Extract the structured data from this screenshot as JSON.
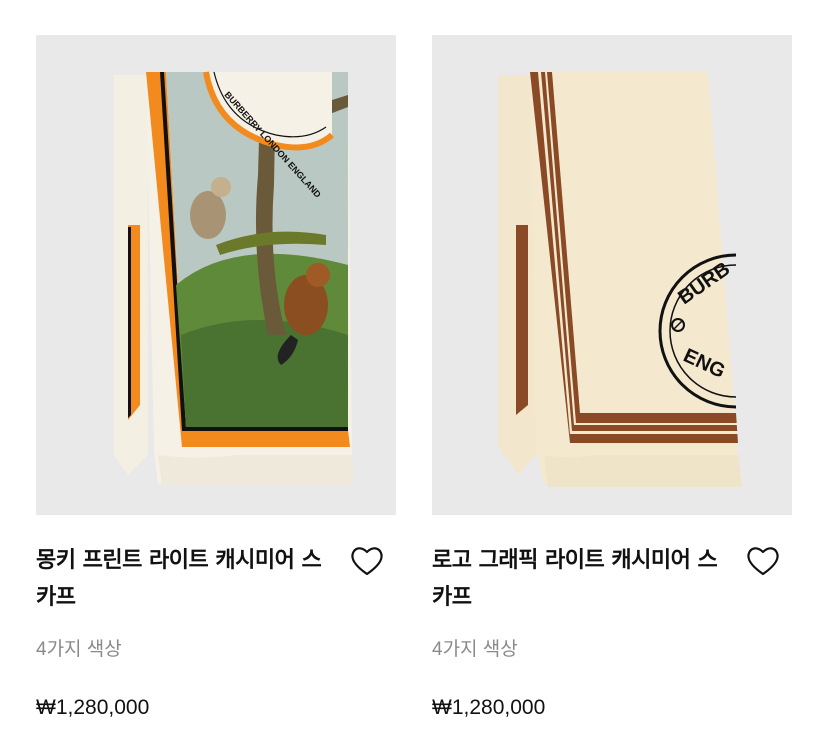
{
  "products": [
    {
      "title": "몽키 프린트 라이트 캐시미어 스카프",
      "colors": "4가지 색상",
      "price": "₩1,280,000",
      "image_icon": "monkey-print-scarf-image",
      "wishlist_icon": "heart-icon",
      "print_text": "BURBERRY LONDON ENGLAND",
      "accent_color": "#f28a1e"
    },
    {
      "title": "로고 그래픽 라이트 캐시미어 스카프",
      "colors": "4가지 색상",
      "price": "₩1,280,000",
      "image_icon": "logo-graphic-scarf-image",
      "wishlist_icon": "heart-icon",
      "print_text_top": "BURB",
      "print_text_bottom": "ENG",
      "accent_color": "#8a4a25"
    }
  ]
}
